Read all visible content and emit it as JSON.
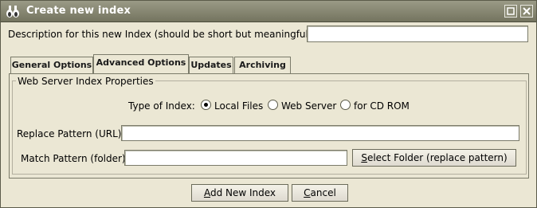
{
  "window": {
    "title": "Create new index",
    "minimize_icon": "minimize-icon",
    "close_icon": "close-icon"
  },
  "description": {
    "label": "Description for this new Index (should be short but meaningful):",
    "value": ""
  },
  "tabs": [
    {
      "label": "General Options",
      "active": false
    },
    {
      "label": "Advanced Options",
      "active": true
    },
    {
      "label": "Updates",
      "active": false
    },
    {
      "label": "Archiving",
      "active": false
    }
  ],
  "web_server_props": {
    "legend": "Web Server Index Properties",
    "type_label": "Type of Index:",
    "options": [
      {
        "label": "Local Files",
        "selected": true
      },
      {
        "label": "Web Server",
        "selected": false
      },
      {
        "label": "for CD ROM",
        "selected": false
      }
    ],
    "replace_label": "Replace Pattern (URL)",
    "replace_value": "",
    "match_label": "Match Pattern (folder)",
    "match_value": "",
    "select_folder_button": "Select Folder (replace pattern)"
  },
  "footer": {
    "add_button": "Add New Index",
    "cancel_button": "Cancel"
  }
}
